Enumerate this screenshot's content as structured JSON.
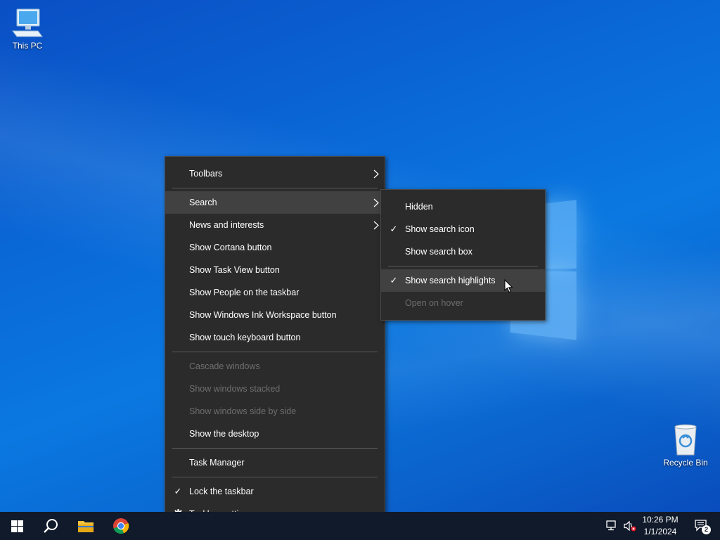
{
  "desktop": {
    "icons": [
      {
        "label": "This PC"
      },
      {
        "label": "Recycle Bin"
      }
    ]
  },
  "context_menu": {
    "items": [
      {
        "label": "Toolbars"
      },
      {
        "label": "Search"
      },
      {
        "label": "News and interests"
      },
      {
        "label": "Show Cortana button"
      },
      {
        "label": "Show Task View button"
      },
      {
        "label": "Show People on the taskbar"
      },
      {
        "label": "Show Windows Ink Workspace button"
      },
      {
        "label": "Show touch keyboard button"
      },
      {
        "label": "Cascade windows"
      },
      {
        "label": "Show windows stacked"
      },
      {
        "label": "Show windows side by side"
      },
      {
        "label": "Show the desktop"
      },
      {
        "label": "Task Manager"
      },
      {
        "label": "Lock the taskbar"
      },
      {
        "label": "Taskbar settings"
      }
    ]
  },
  "search_submenu": {
    "items": [
      {
        "label": "Hidden"
      },
      {
        "label": "Show search icon"
      },
      {
        "label": "Show search box"
      },
      {
        "label": "Show search highlights"
      },
      {
        "label": "Open on hover"
      }
    ]
  },
  "taskbar": {
    "clock_time": "10:26 PM",
    "clock_date": "1/1/2024",
    "notification_count": "2"
  },
  "colors": {
    "menu_background": "#2b2b2b",
    "menu_hover": "#414141",
    "disabled_text": "#6e6e6e",
    "taskbar": "#101a2a"
  }
}
